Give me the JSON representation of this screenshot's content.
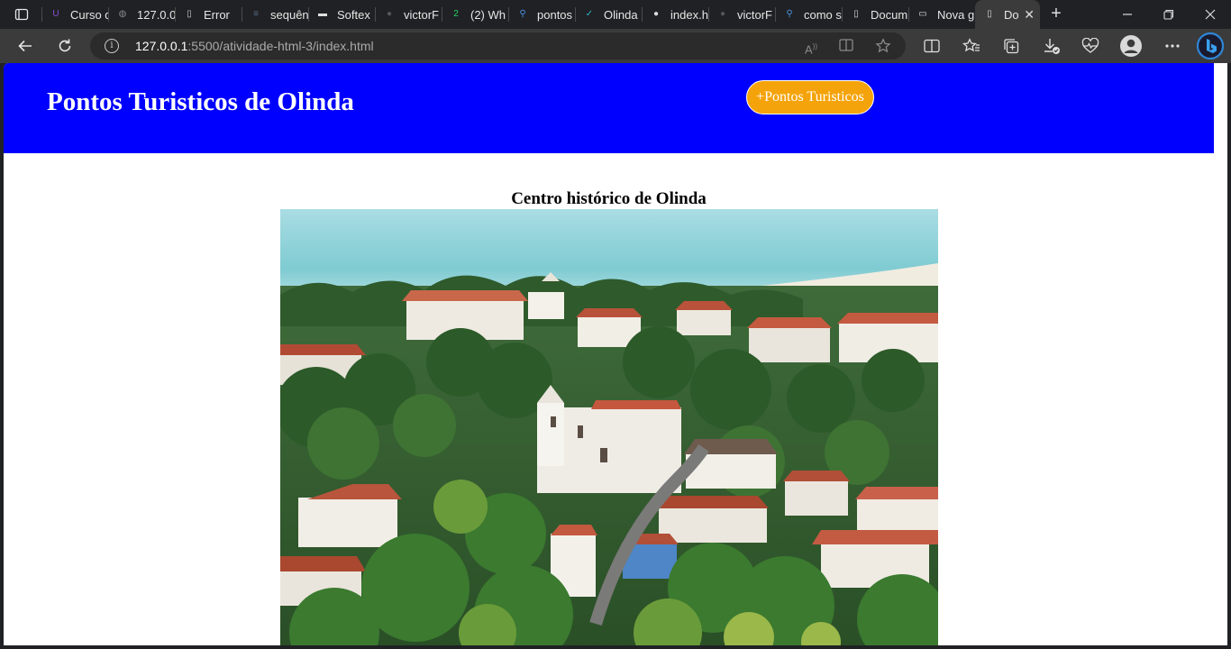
{
  "browser": {
    "tabs": [
      {
        "title": "Curso de",
        "icon": "shield-icon",
        "color": "#8a4fd6"
      },
      {
        "title": "127.0.0.1",
        "icon": "globe-icon",
        "color": "#888888"
      },
      {
        "title": "Error",
        "icon": "page-icon",
        "color": "#cccccc"
      },
      {
        "title": "sequên",
        "icon": "stackoverflow-icon",
        "color": "#5a6f8a"
      },
      {
        "title": "Softex",
        "icon": "softex-icon",
        "color": "#e0e0e0"
      },
      {
        "title": "victorF",
        "icon": "github-icon",
        "color": "#555555"
      },
      {
        "title": "(2) Wh",
        "icon": "whatsapp-icon",
        "color": "#25d366"
      },
      {
        "title": "pontos",
        "icon": "search-icon",
        "color": "#4a90e2"
      },
      {
        "title": "Olinda",
        "icon": "check-icon",
        "color": "#2bb5c9"
      },
      {
        "title": "index.h",
        "icon": "github-icon",
        "color": "#dddddd"
      },
      {
        "title": "victorF",
        "icon": "github-icon",
        "color": "#555555"
      },
      {
        "title": "como s",
        "icon": "search-icon",
        "color": "#4a90e2"
      },
      {
        "title": "Docum",
        "icon": "page-icon",
        "color": "#dddddd"
      },
      {
        "title": "Nova g",
        "icon": "newtab-icon",
        "color": "#dddddd"
      },
      {
        "title": "Do",
        "icon": "page-icon",
        "color": "#dddddd",
        "active": true
      }
    ],
    "address": {
      "host": "127.0.0.1",
      "path": ":5500/atividade-html-3/index.html"
    }
  },
  "page": {
    "title": "Pontos Turisticos de Olinda",
    "cta_label": "+Pontos Turisticos",
    "caption": "Centro histórico de Olinda",
    "header_color": "#0000ff",
    "cta_color": "#f5a30a"
  }
}
